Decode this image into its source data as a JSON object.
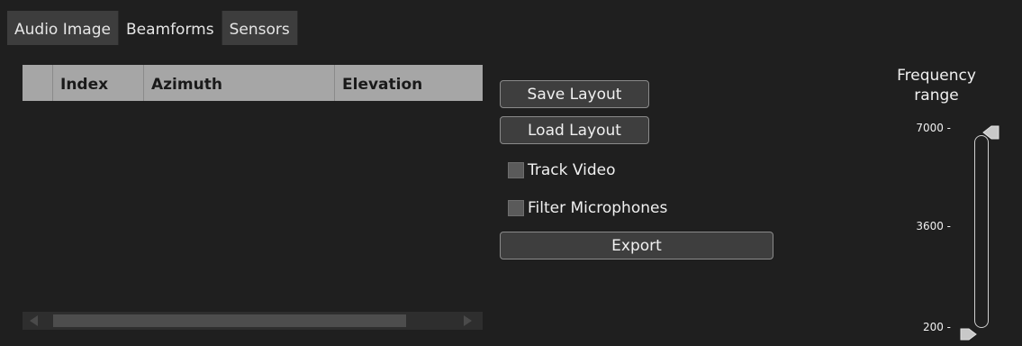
{
  "tabs": [
    {
      "label": "Audio Image",
      "active": false
    },
    {
      "label": "Beamforms",
      "active": true
    },
    {
      "label": "Sensors",
      "active": false
    }
  ],
  "table": {
    "columns": [
      "",
      "Index",
      "Azimuth",
      "Elevation"
    ],
    "rows": []
  },
  "buttons": {
    "save_layout": "Save Layout",
    "load_layout": "Load Layout",
    "export": "Export"
  },
  "checkboxes": {
    "track_video": {
      "label": "Track Video",
      "checked": false
    },
    "filter_microphones": {
      "label": "Filter Microphones",
      "checked": false
    }
  },
  "frequency": {
    "title_line1": "Frequency",
    "title_line2": "range",
    "tick_max": "7000 -",
    "tick_mid": "3600 -",
    "tick_min": "200 -",
    "range_low": 200,
    "range_high": 7000
  },
  "colors": {
    "background": "#1f1f1f",
    "tab_inactive": "#3d3d3d",
    "table_header": "#a6a6a6",
    "button": "#3e3e3e"
  }
}
